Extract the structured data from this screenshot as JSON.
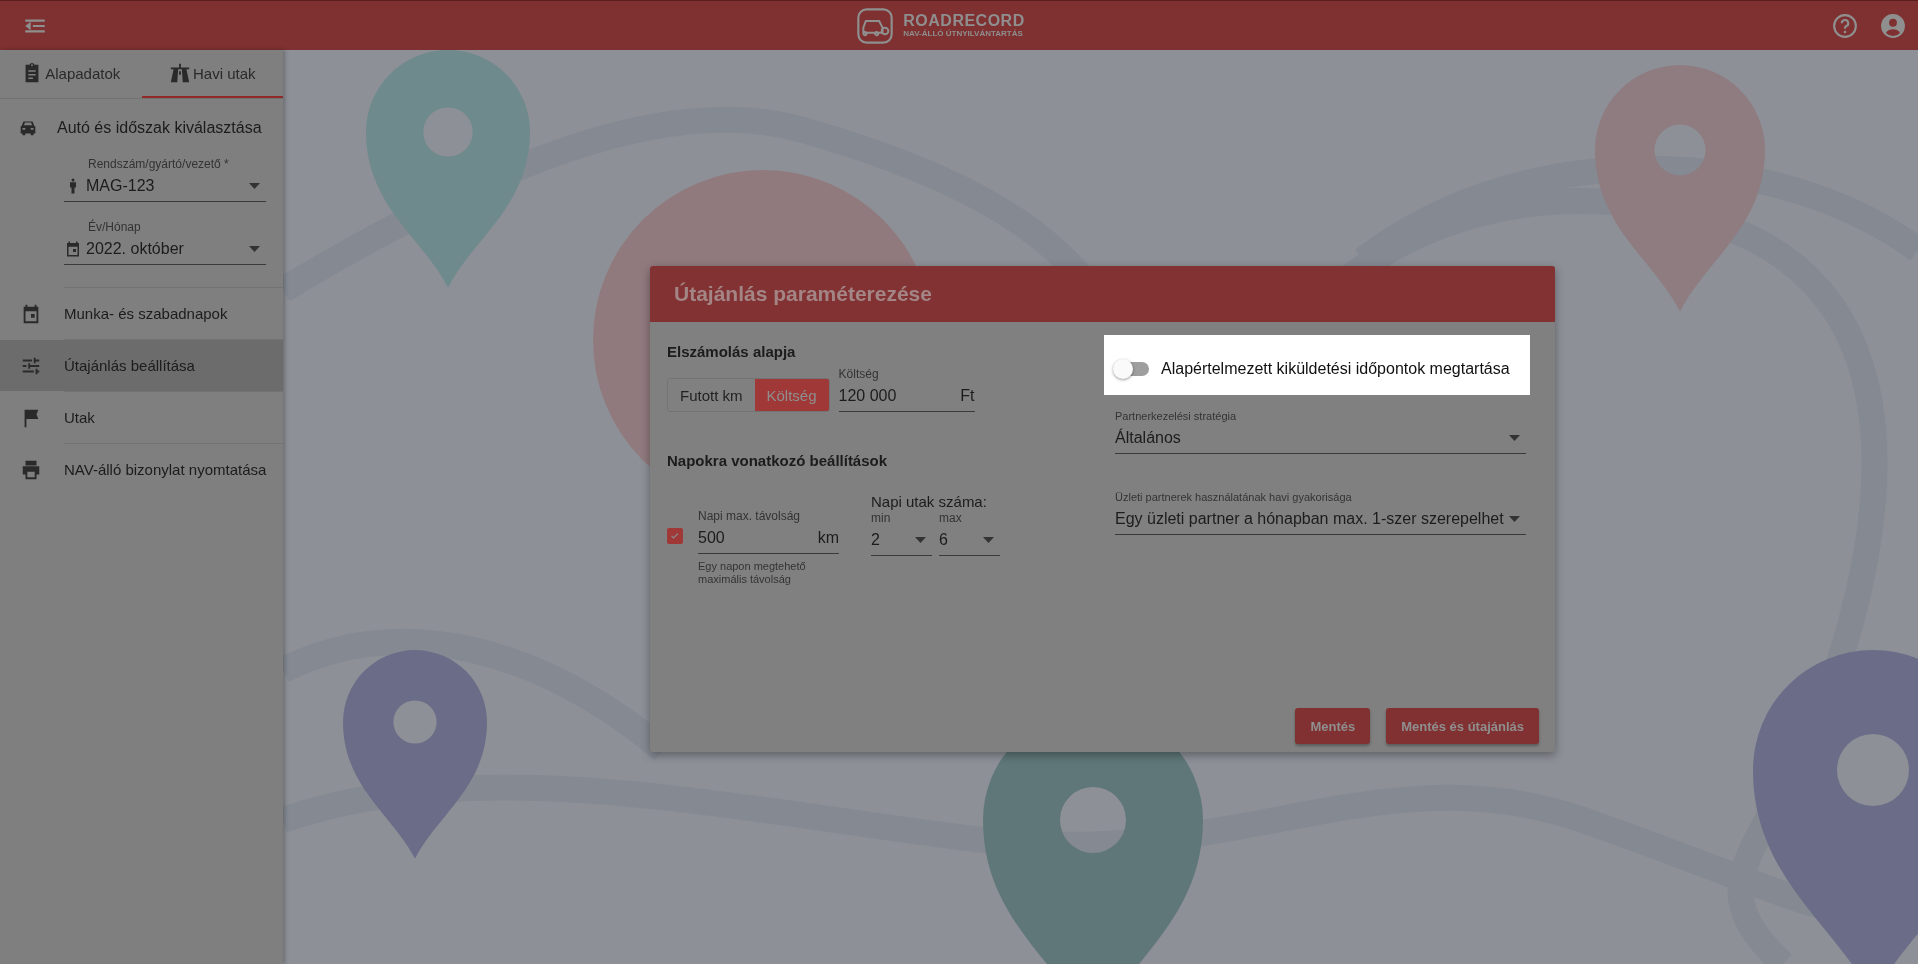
{
  "header": {
    "logo_title": "ROADRECORD",
    "logo_subtitle": "NAV-ÁLLÓ ÚTNYILVÁNTARTÁS"
  },
  "sidebar": {
    "tabs": [
      {
        "label": "Alapadatok",
        "selected": false
      },
      {
        "label": "Havi utak",
        "selected": true
      }
    ],
    "section_title": "Autó és időszak kiválasztása",
    "fields": [
      {
        "label": "Rendszám/gyártó/vezető *",
        "value": "MAG-123"
      },
      {
        "label": "Év/Hónap",
        "value": "2022. október"
      }
    ],
    "nav": [
      {
        "label": "Munka- és szabadnapok",
        "selected": false
      },
      {
        "label": "Útajánlás beállítása",
        "selected": true
      },
      {
        "label": "Utak",
        "selected": false
      },
      {
        "label": "NAV-álló bizonylat nyomtatása",
        "selected": false
      }
    ]
  },
  "dialog": {
    "title": "Útajánlás paraméterezése",
    "billing": {
      "title": "Elszámolás alapja",
      "options": [
        {
          "label": "Futott km",
          "selected": false
        },
        {
          "label": "Költség",
          "selected": true
        }
      ],
      "cost": {
        "label": "Költség",
        "value": "120 000",
        "unit": "Ft"
      }
    },
    "daily": {
      "title": "Napokra vonatkozó beállítások",
      "max_distance": {
        "checked": true,
        "label": "Napi max. távolság",
        "value": "500",
        "unit": "km",
        "hint": "Egy napon megtehető maximális távolság"
      },
      "trips": {
        "title": "Napi utak száma:",
        "min": {
          "label": "min",
          "value": "2"
        },
        "max": {
          "label": "max",
          "value": "6"
        }
      }
    },
    "toggle": {
      "label": "Alapértelmezett kiküldetési időpontok megtartása",
      "on": false
    },
    "selects": [
      {
        "label": "Partnerkezelési stratégia",
        "value": "Általános"
      },
      {
        "label": "Üzleti partnerek használatának havi gyakorisága",
        "value": "Egy üzleti partner a hónapban max. 1-szer szerepelhet"
      }
    ],
    "buttons": [
      "Mentés",
      "Mentés és útajánlás"
    ]
  }
}
